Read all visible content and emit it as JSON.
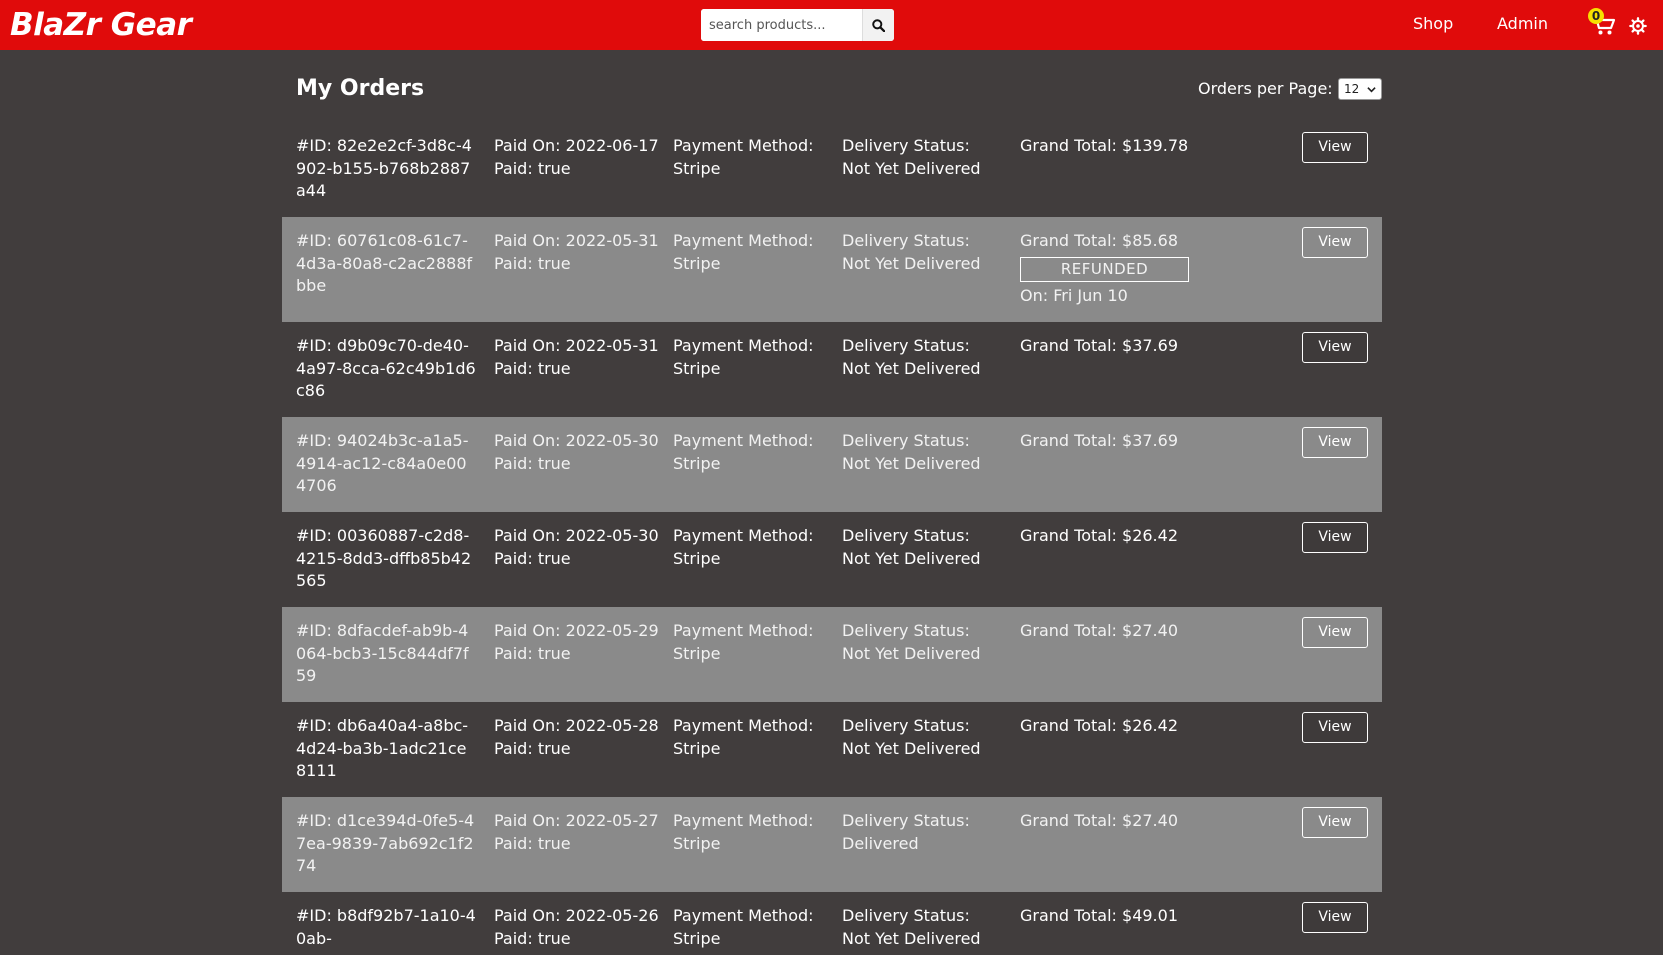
{
  "header": {
    "brand": "BlaZr Gear",
    "search_placeholder": "search products...",
    "nav": {
      "shop": "Shop",
      "admin": "Admin"
    },
    "cart_count": "0"
  },
  "page": {
    "title": "My Orders",
    "per_page_label": "Orders per Page:",
    "per_page_value": "12"
  },
  "orders": [
    {
      "id": "#ID: 82e2e2cf-3d8c-4902-b155-b768b2887a44",
      "paid_on": "Paid On: 2022-06-17",
      "paid": "Paid: true",
      "pm_label": "Payment Method:",
      "pm_value": "Stripe",
      "ds_label": "Delivery Status:",
      "ds_value": "Not Yet Delivered",
      "total": "Grand Total: $139.78",
      "view": "View"
    },
    {
      "id": "#ID: 60761c08-61c7-4d3a-80a8-c2ac2888fbbe",
      "paid_on": "Paid On: 2022-05-31",
      "paid": "Paid: true",
      "pm_label": "Payment Method:",
      "pm_value": "Stripe",
      "ds_label": "Delivery Status:",
      "ds_value": "Not Yet Delivered",
      "total": "Grand Total: $85.68",
      "refund_badge": "REFUNDED",
      "refund_date": "On: Fri Jun 10",
      "view": "View"
    },
    {
      "id": "#ID: d9b09c70-de40-4a97-8cca-62c49b1d6c86",
      "paid_on": "Paid On: 2022-05-31",
      "paid": "Paid: true",
      "pm_label": "Payment Method:",
      "pm_value": "Stripe",
      "ds_label": "Delivery Status:",
      "ds_value": "Not Yet Delivered",
      "total": "Grand Total: $37.69",
      "view": "View"
    },
    {
      "id": "#ID: 94024b3c-a1a5-4914-ac12-c84a0e004706",
      "paid_on": "Paid On: 2022-05-30",
      "paid": "Paid: true",
      "pm_label": "Payment Method:",
      "pm_value": "Stripe",
      "ds_label": "Delivery Status:",
      "ds_value": "Not Yet Delivered",
      "total": "Grand Total: $37.69",
      "view": "View"
    },
    {
      "id": "#ID: 00360887-c2d8-4215-8dd3-dffb85b42565",
      "paid_on": "Paid On: 2022-05-30",
      "paid": "Paid: true",
      "pm_label": "Payment Method:",
      "pm_value": "Stripe",
      "ds_label": "Delivery Status:",
      "ds_value": "Not Yet Delivered",
      "total": "Grand Total: $26.42",
      "view": "View"
    },
    {
      "id": "#ID: 8dfacdef-ab9b-4064-bcb3-15c844df7f59",
      "paid_on": "Paid On: 2022-05-29",
      "paid": "Paid: true",
      "pm_label": "Payment Method:",
      "pm_value": "Stripe",
      "ds_label": "Delivery Status:",
      "ds_value": "Not Yet Delivered",
      "total": "Grand Total: $27.40",
      "view": "View"
    },
    {
      "id": "#ID: db6a40a4-a8bc-4d24-ba3b-1adc21ce8111",
      "paid_on": "Paid On: 2022-05-28",
      "paid": "Paid: true",
      "pm_label": "Payment Method:",
      "pm_value": "Stripe",
      "ds_label": "Delivery Status:",
      "ds_value": "Not Yet Delivered",
      "total": "Grand Total: $26.42",
      "view": "View"
    },
    {
      "id": "#ID: d1ce394d-0fe5-47ea-9839-7ab692c1f274",
      "paid_on": "Paid On: 2022-05-27",
      "paid": "Paid: true",
      "pm_label": "Payment Method:",
      "pm_value": "Stripe",
      "ds_label": "Delivery Status:",
      "ds_value": "Delivered",
      "total": "Grand Total: $27.40",
      "view": "View"
    },
    {
      "id": "#ID: b8df92b7-1a10-40ab-",
      "paid_on": "Paid On: 2022-05-26",
      "paid": "Paid: true",
      "pm_label": "Payment Method:",
      "pm_value": "Stripe",
      "ds_label": "Delivery Status:",
      "ds_value": "Not Yet Delivered",
      "total": "Grand Total: $49.01",
      "view": "View"
    }
  ]
}
